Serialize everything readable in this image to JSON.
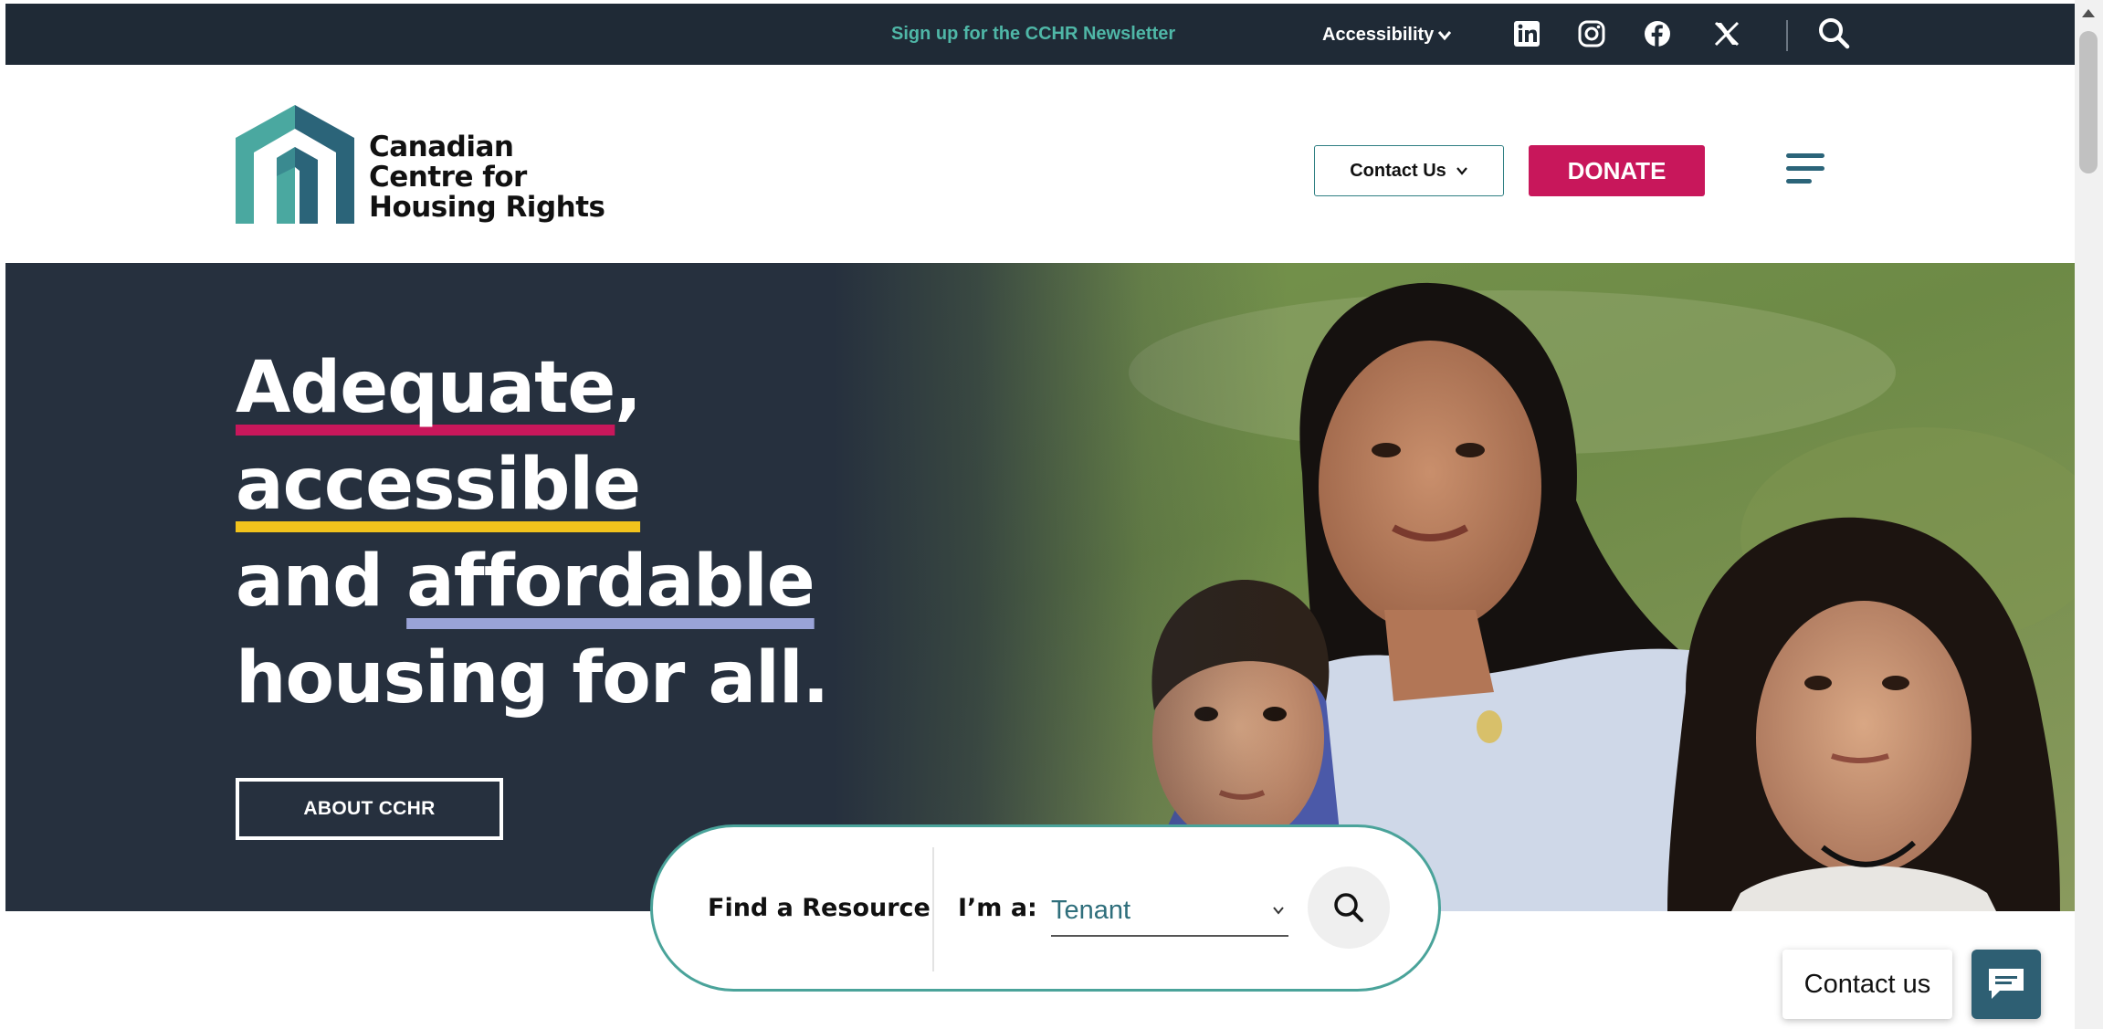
{
  "topbar": {
    "newsletter": "Sign up for the CCHR Newsletter",
    "accessibility": "Accessibility",
    "social_icons": [
      "linkedin-icon",
      "instagram-icon",
      "facebook-icon",
      "x-icon"
    ],
    "search_icon": "search-icon"
  },
  "header": {
    "logo_lines": [
      "Canadian",
      "Centre for",
      "Housing Rights"
    ],
    "contact_us": "Contact Us",
    "donate": "DONATE",
    "menu_icon": "hamburger-icon"
  },
  "hero": {
    "word1": "Adequate",
    "comma": ",",
    "word2": "accessible",
    "and": "and ",
    "word3": "affordable",
    "line4": "housing for all.",
    "about_button": "ABOUT CCHR"
  },
  "finder": {
    "label": "Find a Resource",
    "im_a": "I’m a:",
    "selected": "Tenant"
  },
  "floating": {
    "contact": "Contact us",
    "chat_icon": "chat-icon"
  },
  "colors": {
    "topbar_bg": "#1f2a36",
    "teal": "#4fb7a7",
    "donate": "#c8175b",
    "underline_pink": "#c8175b",
    "underline_yellow": "#f2c31c",
    "underline_lilac": "#9aa3d8",
    "hero_dark": "#26303e"
  }
}
